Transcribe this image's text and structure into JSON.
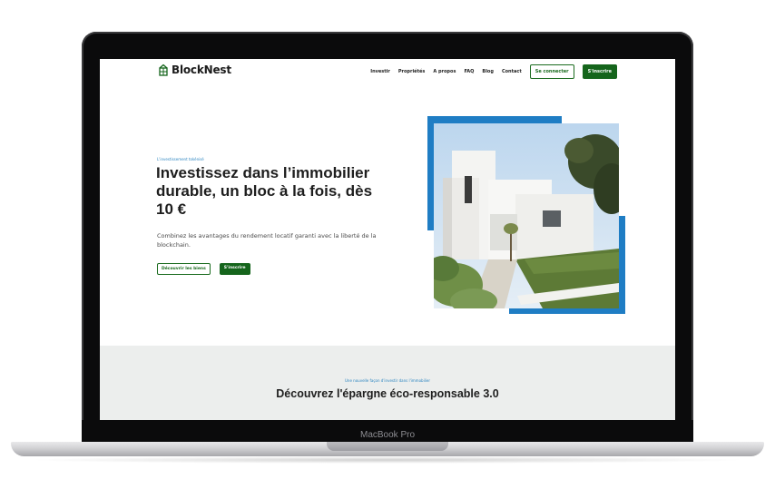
{
  "device": {
    "model_label": "MacBook Pro"
  },
  "brand": {
    "name": "BlockNest",
    "primary_color": "#15651c",
    "accent_color": "#1f7dc4"
  },
  "nav": {
    "links": [
      "Investir",
      "Propriétés",
      "A propos",
      "FAQ",
      "Blog",
      "Contact"
    ],
    "login_label": "Se connecter",
    "signup_label": "S'inscrire"
  },
  "hero": {
    "tag": "L'investissement tokénisé",
    "title": "Investissez dans l’immobilier durable, un bloc à la fois, dès 10 €",
    "subtitle": "Combinez les avantages du rendement locatif garanti avec la liberté de la blockchain.",
    "primary_cta": "Découvrir les biens",
    "secondary_cta": "S'inscrire",
    "image": "white-modern-villa-photo"
  },
  "section2": {
    "tag": "Une nouvelle façon d'investir dans l'immobilier",
    "title": "Découvrez l'épargne éco-responsable 3.0"
  }
}
